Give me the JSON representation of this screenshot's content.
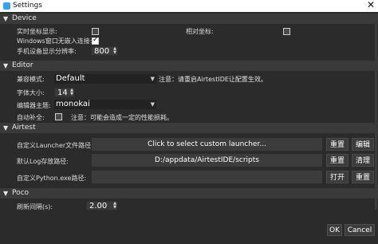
{
  "window": {
    "title": "Settings",
    "close_glyph": "✕"
  },
  "device": {
    "header": "Device",
    "show_coords_label": "实时坐标显示:",
    "relative_coords_label": "相对坐标:",
    "windows_embed_label": "Windows窗口无嵌入连接:",
    "windows_embed_checked": true,
    "phone_resolution_label": "手机设备显示分辨率:",
    "phone_resolution_value": "800"
  },
  "editor": {
    "header": "Editor",
    "compat_mode_label": "兼容模式:",
    "compat_mode_value": "Default",
    "compat_hint": "注意：请重启AirtestIDE让配置生效。",
    "font_size_label": "字体大小:",
    "font_size_value": "14",
    "theme_label": "编辑器主题:",
    "theme_value": "monokai",
    "autocomplete_label": "自动补全:",
    "autocomplete_hint": "注意：可能会造成一定的性能损耗。"
  },
  "airtest": {
    "header": "Airtest",
    "launcher_label": "自定义Launcher文件路径:",
    "launcher_value": "Click to select custom launcher...",
    "launcher_reset": "重置",
    "launcher_edit": "编辑",
    "log_label": "默认Log存放路径:",
    "log_value": "D:/appdata/AirtestIDE/scripts",
    "log_reset": "重置",
    "log_clear": "清理",
    "python_label": "自定义Python.exe路径:",
    "python_value": "",
    "python_open": "打开",
    "python_reset": "重置"
  },
  "poco": {
    "header": "Poco",
    "refresh_label": "刷新间隔(s):",
    "refresh_value": "2.00"
  },
  "footer": {
    "ok": "OK",
    "cancel": "Cancel"
  }
}
